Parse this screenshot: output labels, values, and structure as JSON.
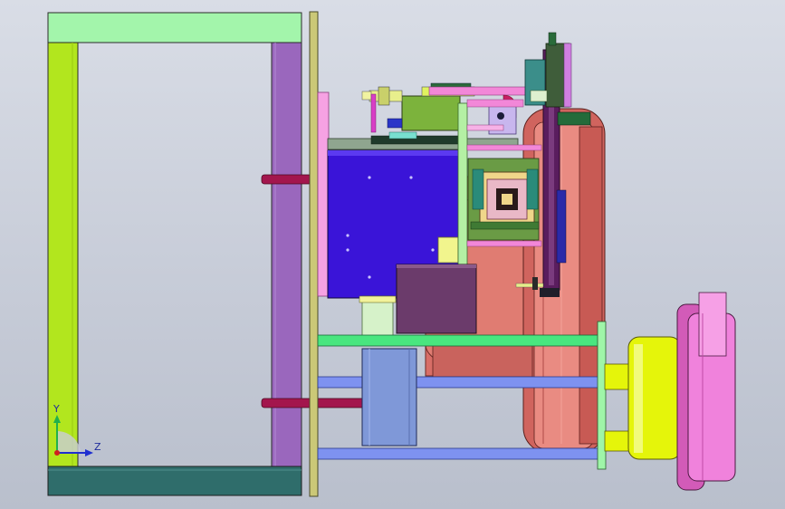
{
  "triad": {
    "y_label": "Y",
    "z_label": "Z"
  },
  "colors": {
    "background": "#cdd2dc",
    "frame_top": "#9ff5a8",
    "frame_left": "#b0e61c",
    "frame_right": "#9968bd",
    "frame_base": "#2f6d6b",
    "plate": "#c9c678",
    "blue_block": "#3a14d8",
    "drum": "#e07a70",
    "pink": "#f07fd8",
    "yellow": "#e5f50a",
    "purple": "#6d3b6b",
    "rod_blue": "#7e92f0",
    "rod_green": "#49e67f",
    "motor_blue": "#7f98d8"
  }
}
